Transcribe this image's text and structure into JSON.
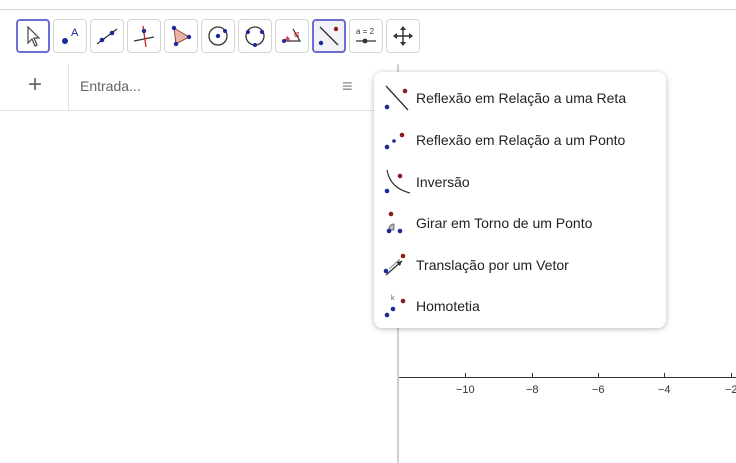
{
  "toolbar": {
    "tools": [
      {
        "name": "move-tool-icon"
      },
      {
        "name": "point-tool-icon",
        "label": "A"
      },
      {
        "name": "line-tool-icon"
      },
      {
        "name": "perpendicular-line-tool-icon"
      },
      {
        "name": "polygon-tool-icon"
      },
      {
        "name": "circle-tool-icon"
      },
      {
        "name": "circle-three-points-tool-icon"
      },
      {
        "name": "angle-tool-icon",
        "label": "α"
      },
      {
        "name": "reflect-about-line-tool-icon"
      },
      {
        "name": "slider-tool-icon",
        "label": "a = 2"
      },
      {
        "name": "move-graphics-view-tool-icon"
      }
    ]
  },
  "algebra": {
    "add_icon": "+",
    "input_placeholder": "Entrada...",
    "style_icon": "≡"
  },
  "axis": {
    "tick_labels": [
      "−10",
      "−8",
      "−6",
      "−4",
      "−2"
    ]
  },
  "menu": {
    "items": [
      {
        "label": "Reflexão em Relação a uma Reta",
        "icon": "reflect-about-line-icon"
      },
      {
        "label": "Reflexão em Relação a um Ponto",
        "icon": "reflect-about-point-icon"
      },
      {
        "label": "Inversão",
        "icon": "inversion-icon"
      },
      {
        "label": "Girar em Torno de um Ponto",
        "icon": "rotate-around-point-icon"
      },
      {
        "label": "Translação por um Vetor",
        "icon": "translate-by-vector-icon"
      },
      {
        "label": "Homotetia",
        "icon": "dilate-from-point-icon"
      }
    ]
  },
  "colors": {
    "accent": "#6b6fd6",
    "point_blue": "#1a2a9a",
    "point_red": "#8a1c1c"
  }
}
